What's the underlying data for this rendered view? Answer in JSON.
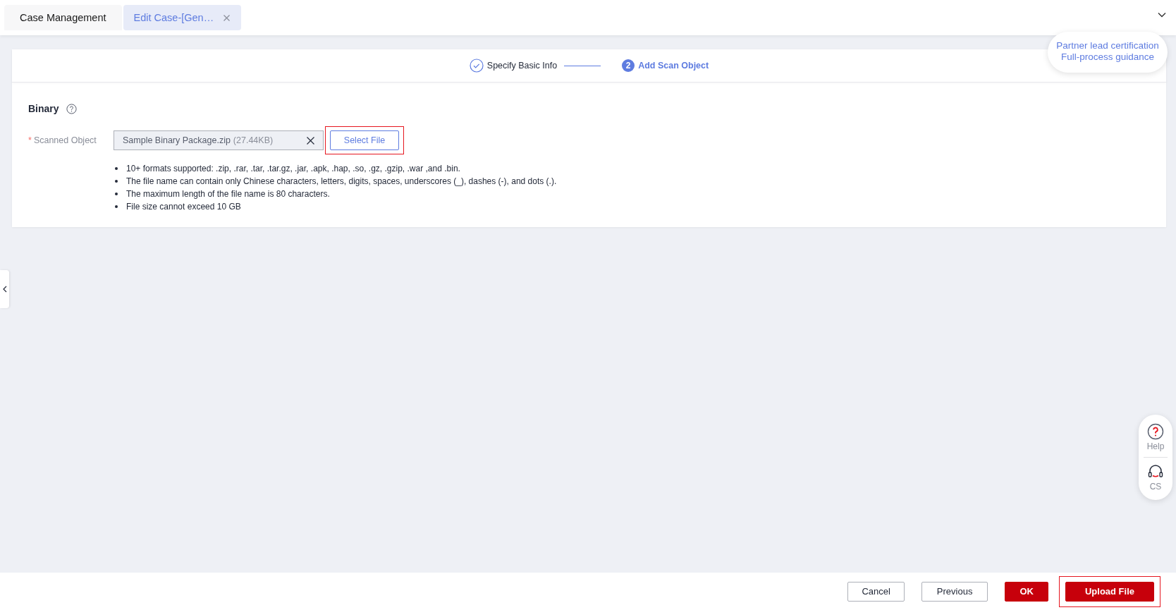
{
  "tabs": [
    {
      "label": "Case Management",
      "selected": false,
      "closable": false
    },
    {
      "label": "Edit Case-[Gen…",
      "selected": true,
      "closable": true
    }
  ],
  "steps": [
    {
      "label": "Specify Basic Info",
      "completed": true
    },
    {
      "label": "Add Scan Object",
      "completed": false,
      "number": "2"
    }
  ],
  "guide": {
    "lines": [
      "Partner lead certification",
      "Full-process guidance"
    ]
  },
  "section": {
    "title": "Binary",
    "field_label": "Scanned Object",
    "required_mark": "*",
    "file_name": "Sample Binary Package.zip",
    "file_size": "(27.44KB)",
    "select_button": {
      "label": "Select File",
      "highlighted": true
    },
    "notes": [
      "10+ formats supported: .zip, .rar, .tar, .tar.gz, .jar, .apk, .hap, .so, .gz, .gzip, .war ,and .bin.",
      "The file name can contain only Chinese characters, letters, digits, spaces, underscores (_), dashes (-), and dots (.).",
      "The maximum length of the file name is 80 characters.",
      "File size cannot exceed 10 GB"
    ]
  },
  "dock": [
    {
      "kind": "help",
      "label": "Help"
    },
    {
      "kind": "cs",
      "label": "CS"
    }
  ],
  "footer": [
    {
      "label": "Cancel",
      "kind": "default",
      "highlighted": false
    },
    {
      "label": "Previous",
      "kind": "default",
      "highlighted": false
    },
    {
      "label": "OK",
      "kind": "primary",
      "highlighted": false
    },
    {
      "label": "Upload File",
      "kind": "primary",
      "highlighted": true
    }
  ]
}
